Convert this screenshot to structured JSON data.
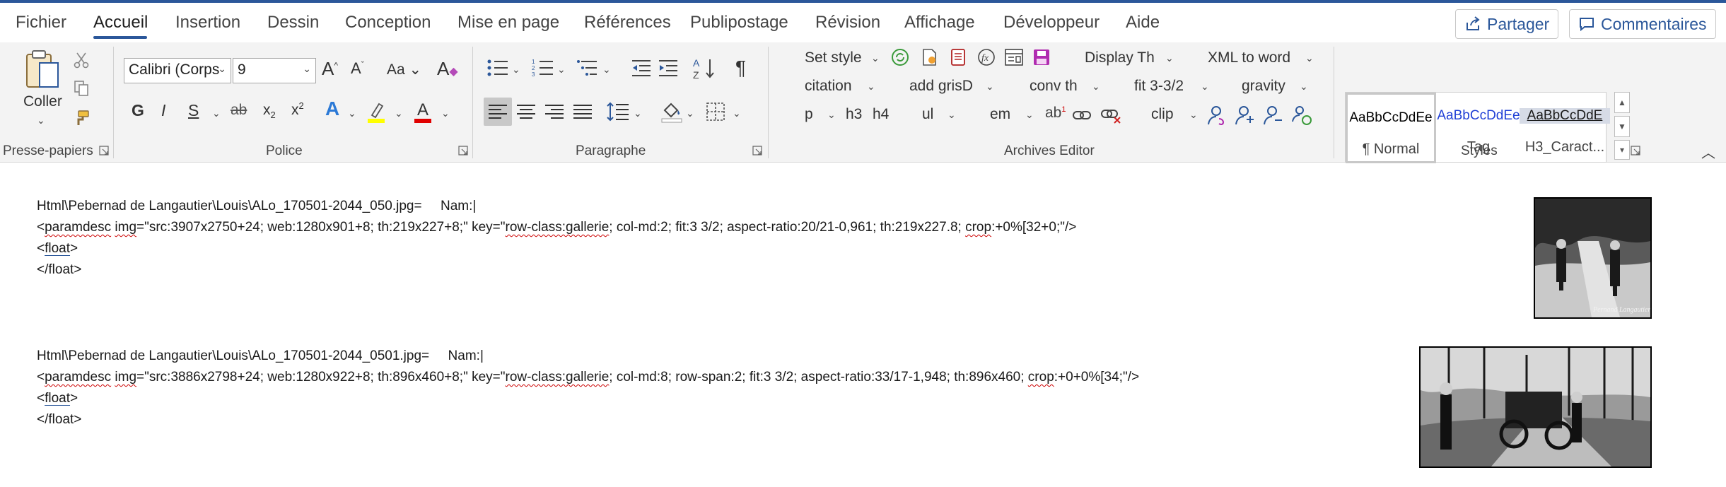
{
  "tabs": [
    "Fichier",
    "Accueil",
    "Insertion",
    "Dessin",
    "Conception",
    "Mise en page",
    "Références",
    "Publipostage",
    "Révision",
    "Affichage",
    "Développeur",
    "Aide"
  ],
  "active_tab": "Accueil",
  "header": {
    "share_label": "Partager",
    "comments_label": "Commentaires"
  },
  "groups": {
    "clipboard": {
      "label": "Presse-papiers",
      "paste_label": "Coller"
    },
    "font": {
      "label": "Police",
      "font_name": "Calibri (Corps",
      "font_size": "9",
      "case_label": "Aa"
    },
    "paragraph": {
      "label": "Paragraphe"
    },
    "archives": {
      "label": "Archives Editor",
      "row1": [
        "Set style",
        "Display Th",
        "XML to word"
      ],
      "row2": [
        "citation",
        "add grisD",
        "conv th",
        "fit 3-3/2",
        "gravity"
      ],
      "row3": [
        "p",
        "h3",
        "h4",
        "ul",
        "em",
        "clip"
      ]
    },
    "styles": {
      "label": "Styles",
      "items": [
        {
          "sample": "AaBbCcDdEe",
          "name": "¶ Normal",
          "color": "#000000"
        },
        {
          "sample": "AaBbCcDdEe",
          "name": "Tag",
          "color": "#1f3fd6"
        },
        {
          "sample": "AaBbCcDdE",
          "name": "H3_Caract...",
          "color": "#1a1a1a"
        }
      ]
    }
  },
  "document": {
    "entries": [
      {
        "path": "Html\\Pebernad de Langautier\\Louis\\ALo_170501-2044_050.jpg=",
        "nam": "Nam:|",
        "pre": "<",
        "pd": "paramdesc",
        "sp1": " ",
        "img": "img",
        "m1": "=\"src:3907x2750+24; web:1280x901+8; th:219x227+8;\" key=\"",
        "rc": "row-class:gallerie",
        "m2": "; col-md:2; fit:3 3/2; aspect-ratio:20/21-0,961; th:219x227.8; ",
        "crop": "crop",
        "m3": ":+0%[32+0;\"/>",
        "float_open_l": "<",
        "float_word": "float",
        "float_open_r": ">",
        "float_close": "</float>"
      },
      {
        "path": "Html\\Pebernad de Langautier\\Louis\\ALo_170501-2044_0501.jpg=",
        "nam": "Nam:|",
        "pre": "<",
        "pd": "paramdesc",
        "sp1": " ",
        "img": "img",
        "m1": "=\"src:3886x2798+24; web:1280x922+8; th:896x460+8;\" key=\"",
        "rc": "row-class:gallerie",
        "m2": "; col-md:8; row-span:2; fit:3 3/2; aspect-ratio:33/17-1,948; th:896x460; ",
        "crop": "crop",
        "m3": ":+0+0%[34;\"/>",
        "float_open_l": "<",
        "float_word": "float",
        "float_open_r": ">",
        "float_close": "</float>"
      }
    ],
    "photo1_caption": "Pernand Langautier"
  },
  "colors": {
    "accent": "#2b579a",
    "ribbon_bg": "#f3f3f3"
  }
}
